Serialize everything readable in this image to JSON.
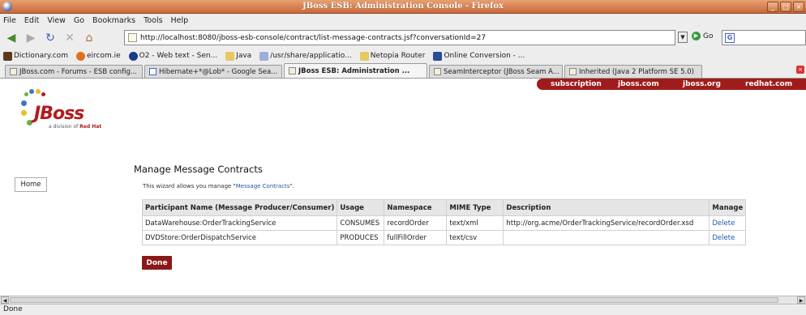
{
  "window": {
    "title": "JBoss ESB: Administration Console - Firefox"
  },
  "menu": [
    "File",
    "Edit",
    "View",
    "Go",
    "Bookmarks",
    "Tools",
    "Help"
  ],
  "nav": {
    "url": "http://localhost:8080/jboss-esb-console/contract/list-message-contracts.jsf?conversationId=27",
    "go_label": "Go",
    "search_icon": "G"
  },
  "bookmarks": [
    {
      "label": "Dictionary.com",
      "color": "#5a3a1a"
    },
    {
      "label": "eircom.ie",
      "color": "#e07020"
    },
    {
      "label": "O2 - Web text - Sen...",
      "color": "#1a3a8a"
    },
    {
      "label": "Java",
      "color": "#e8c860"
    },
    {
      "label": "/usr/share/applicatio...",
      "color": "#9ab0d8"
    },
    {
      "label": "Netopia Router",
      "color": "#e8c860"
    },
    {
      "label": "Online Conversion - ...",
      "color": "#2a4a9a"
    }
  ],
  "tabs": [
    {
      "label": "JBoss.com - Forums - ESB config...",
      "active": false
    },
    {
      "label": "Hibernate+*@Lob* - Google Sea...",
      "active": false
    },
    {
      "label": "JBoss ESB: Administration ...",
      "active": true
    },
    {
      "label": "SeamInterceptor (JBoss Seam A...",
      "active": false
    },
    {
      "label": "Inherited (Java 2 Platform SE 5.0)",
      "active": false
    }
  ],
  "site_links": [
    "subscription",
    "jboss.com",
    "jboss.org",
    "redhat.com"
  ],
  "logo": {
    "word": "JBoss",
    "sub_prefix": "a division of",
    "sub_brand": "Red Hat"
  },
  "side_nav": {
    "home": "Home"
  },
  "page": {
    "title": "Manage Message Contracts",
    "desc_prefix": "This wizard allows you manage \"",
    "desc_link": "Message Contracts",
    "desc_suffix": "\"."
  },
  "table": {
    "headers": [
      "Participant Name (Message Producer/Consumer)",
      "Usage",
      "Namespace",
      "MIME Type",
      "Description",
      "Manage"
    ],
    "rows": [
      [
        "DataWarehouse:OrderTrackingService",
        "CONSUMES",
        "recordOrder",
        "text/xml",
        "http://org.acme/OrderTrackingService/recordOrder.xsd",
        "Delete"
      ],
      [
        "DVDStore:OrderDispatchService",
        "PRODUCES",
        "fullFillOrder",
        "text/csv",
        "",
        "Delete"
      ]
    ]
  },
  "done_button": "Done",
  "status": "Done"
}
